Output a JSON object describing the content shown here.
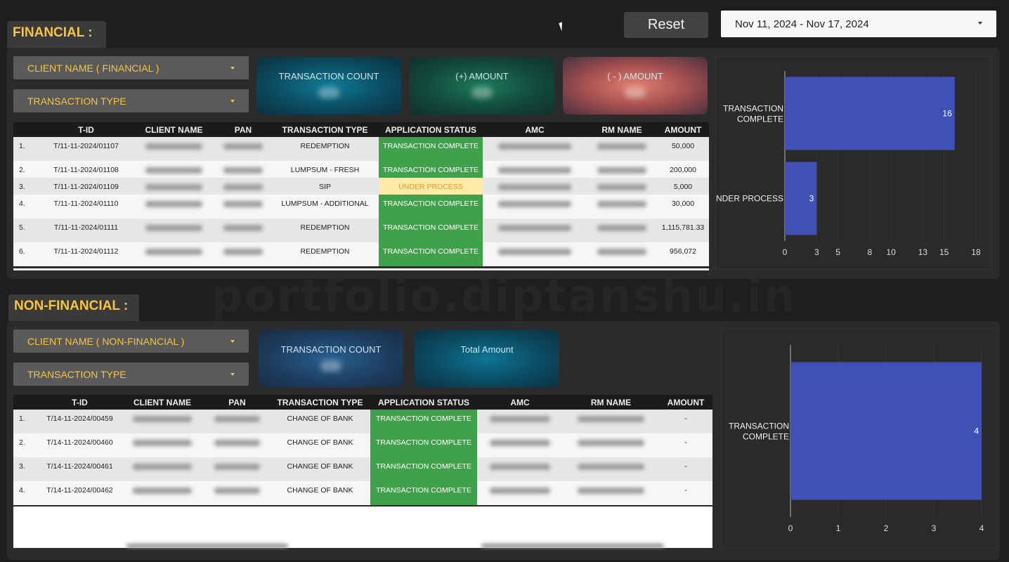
{
  "header": {
    "reset_label": "Reset",
    "date_range": "Nov 11, 2024 - Nov 17, 2024"
  },
  "watermark": "portfolio.diptanshu.in",
  "financial": {
    "title": "FINANCIAL :",
    "filters": {
      "client": "CLIENT NAME ( FINANCIAL )",
      "type": "TRANSACTION TYPE"
    },
    "kpis": [
      "TRANSACTION COUNT",
      "(+) AMOUNT",
      "( - ) AMOUNT"
    ],
    "columns": [
      "",
      "T-ID",
      "CLIENT NAME",
      "PAN",
      "TRANSACTION TYPE",
      "APPLICATION STATUS",
      "AMC",
      "RM NAME",
      "AMOUNT"
    ],
    "rows": [
      {
        "n": "1.",
        "tid": "T/11-11-2024/01107",
        "type": "REDEMPTION",
        "status": "TRANSACTION COMPLETE",
        "amount": "50,000"
      },
      {
        "n": "2.",
        "tid": "T/11-11-2024/01108",
        "type": "LUMPSUM - FRESH",
        "status": "TRANSACTION COMPLETE",
        "amount": "200,000"
      },
      {
        "n": "3.",
        "tid": "T/11-11-2024/01109",
        "type": "SIP",
        "status": "UNDER PROCESS",
        "amount": "5,000"
      },
      {
        "n": "4.",
        "tid": "T/11-11-2024/01110",
        "type": "LUMPSUM - ADDITIONAL",
        "status": "TRANSACTION COMPLETE",
        "amount": "30,000"
      },
      {
        "n": "5.",
        "tid": "T/11-11-2024/01111",
        "type": "REDEMPTION",
        "status": "TRANSACTION COMPLETE",
        "amount": "1,115,781.33"
      },
      {
        "n": "6.",
        "tid": "T/11-11-2024/01112",
        "type": "REDEMPTION",
        "status": "TRANSACTION COMPLETE",
        "amount": "956,072"
      }
    ]
  },
  "non_financial": {
    "title": "NON-FINANCIAL :",
    "filters": {
      "client": "CLIENT NAME ( NON-FINANCIAL )",
      "type": "TRANSACTION TYPE"
    },
    "kpis": [
      "TRANSACTION COUNT",
      "Total Amount"
    ],
    "columns": [
      "",
      "T-ID",
      "CLIENT NAME",
      "PAN",
      "TRANSACTION TYPE",
      "APPLICATION STATUS",
      "AMC",
      "RM NAME",
      "AMOUNT"
    ],
    "rows": [
      {
        "n": "1.",
        "tid": "T/14-11-2024/00459",
        "type": "CHANGE OF BANK",
        "status": "TRANSACTION COMPLETE",
        "amount": "-"
      },
      {
        "n": "2.",
        "tid": "T/14-11-2024/00460",
        "type": "CHANGE OF BANK",
        "status": "TRANSACTION COMPLETE",
        "amount": "-"
      },
      {
        "n": "3.",
        "tid": "T/14-11-2024/00461",
        "type": "CHANGE OF BANK",
        "status": "TRANSACTION COMPLETE",
        "amount": "-"
      },
      {
        "n": "4.",
        "tid": "T/14-11-2024/00462",
        "type": "CHANGE OF BANK",
        "status": "TRANSACTION COMPLETE",
        "amount": "-"
      }
    ]
  },
  "chart_data": [
    {
      "type": "bar",
      "orientation": "horizontal",
      "categories": [
        "TRANSACTION COMPLETE",
        "UNDER PROCESS"
      ],
      "values": [
        16,
        3
      ],
      "xlim": [
        0,
        18
      ],
      "ticks": [
        0,
        3,
        5,
        8,
        10,
        13,
        15,
        18
      ],
      "bar_color": "#3f51b5"
    },
    {
      "type": "bar",
      "orientation": "horizontal",
      "categories": [
        "TRANSACTION COMPLETE"
      ],
      "values": [
        4
      ],
      "xlim": [
        0,
        4
      ],
      "ticks": [
        0,
        1,
        2,
        3,
        4
      ],
      "bar_color": "#3f51b5"
    }
  ]
}
